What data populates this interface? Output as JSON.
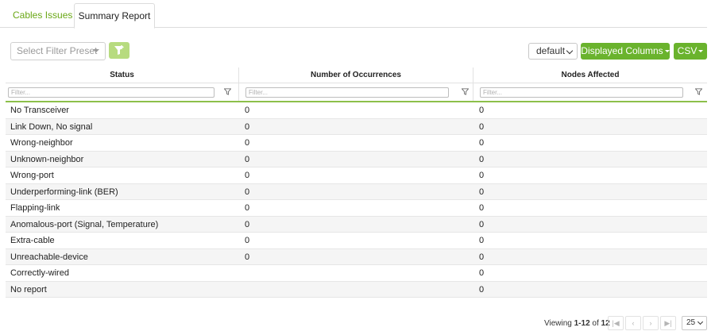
{
  "tabs": [
    {
      "label": "Cables Issues",
      "active": false
    },
    {
      "label": "Summary Report",
      "active": true
    }
  ],
  "toolbar": {
    "filter_preset_placeholder": "Select Filter Preset",
    "view_select_value": "default",
    "displayed_columns_label": "Displayed Columns",
    "csv_label": "CSV"
  },
  "table": {
    "columns": [
      "Status",
      "Number of Occurrences",
      "Nodes Affected"
    ],
    "filter_placeholder": "Filter...",
    "rows": [
      {
        "status": "No Transceiver",
        "occurrences": "0",
        "nodes": "0"
      },
      {
        "status": "Link Down, No signal",
        "occurrences": "0",
        "nodes": "0"
      },
      {
        "status": "Wrong-neighbor",
        "occurrences": "0",
        "nodes": "0"
      },
      {
        "status": "Unknown-neighbor",
        "occurrences": "0",
        "nodes": "0"
      },
      {
        "status": "Wrong-port",
        "occurrences": "0",
        "nodes": "0"
      },
      {
        "status": "Underperforming-link (BER)",
        "occurrences": "0",
        "nodes": "0"
      },
      {
        "status": "Flapping-link",
        "occurrences": "0",
        "nodes": "0"
      },
      {
        "status": "Anomalous-port (Signal, Temperature)",
        "occurrences": "0",
        "nodes": "0"
      },
      {
        "status": "Extra-cable",
        "occurrences": "0",
        "nodes": "0"
      },
      {
        "status": "Unreachable-device",
        "occurrences": "0",
        "nodes": "0"
      },
      {
        "status": "Correctly-wired",
        "occurrences": "",
        "nodes": "0"
      },
      {
        "status": "No report",
        "occurrences": "",
        "nodes": "0"
      }
    ]
  },
  "pager": {
    "viewing_prefix": "Viewing",
    "range": "1-12",
    "of_label": "of",
    "total": "12",
    "page_size": "25"
  },
  "colors": {
    "accent": "#6ab32d",
    "tab_link": "#6aa716",
    "apply_button": "#b7db7f"
  }
}
